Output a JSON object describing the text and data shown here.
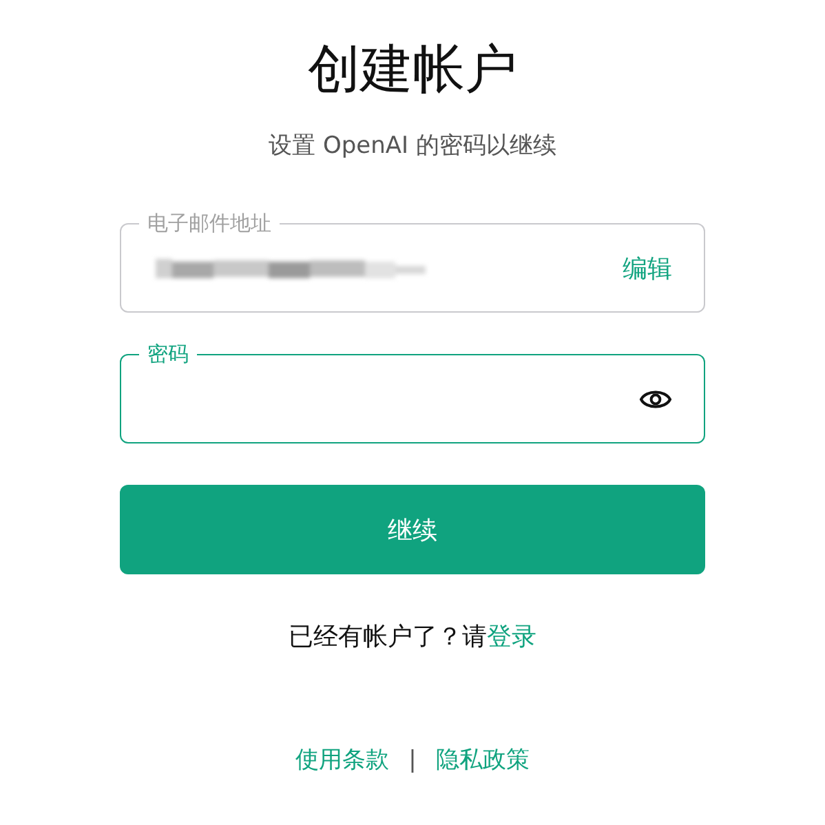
{
  "title": "创建帐户",
  "subtitle": "设置 OpenAI 的密码以继续",
  "fields": [
    {
      "kind": "email",
      "label": "电子邮件地址",
      "action": "编辑",
      "focused": false
    },
    {
      "kind": "password",
      "label": "密码",
      "focused": true
    }
  ],
  "continue_button": "继续",
  "login_prompt": {
    "text": "已经有帐户了？请",
    "link": "登录"
  },
  "footer": {
    "links": [
      "使用条款",
      "隐私政策"
    ],
    "separator": "|"
  }
}
